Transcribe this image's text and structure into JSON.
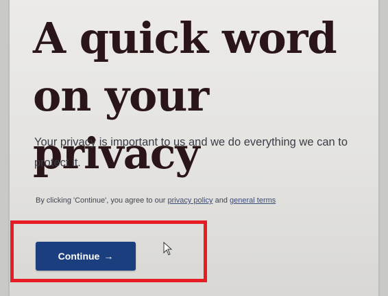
{
  "headline": {
    "line1": "A quick word",
    "line2": "on your privacy"
  },
  "body": {
    "text": "Your privacy is important to us and we do everything we can to protect it."
  },
  "consent": {
    "prefix": "By clicking 'Continue', you agree to our ",
    "privacy_link": "privacy policy",
    "middle": " and ",
    "terms_link": "general terms"
  },
  "continue_button": {
    "label": "Continue",
    "arrow": "→",
    "color": "#1b3f7e"
  },
  "annotation": {
    "highlight_color": "#e61d25"
  },
  "icons": {
    "arrow": "arrow-right-icon",
    "cursor": "mouse-cursor-icon"
  }
}
